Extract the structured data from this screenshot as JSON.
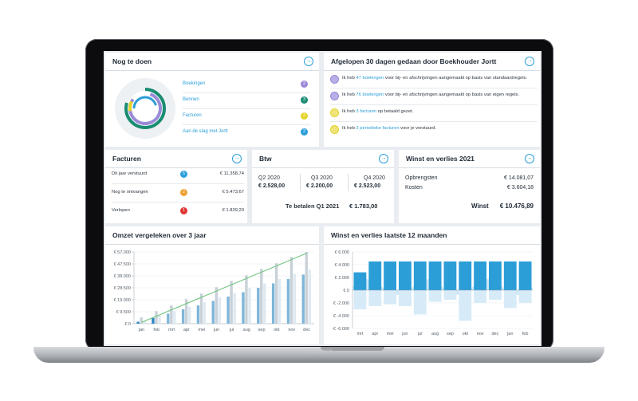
{
  "device": {
    "brand": "MacBook"
  },
  "colors": {
    "accent": "#2b9ed8",
    "green": "#5bbf6b",
    "purple": "#9b8ad8",
    "yellow": "#e3d42a",
    "orange": "#f0a030",
    "red": "#e03535",
    "teal": "#1a8c72"
  },
  "todo": {
    "title": "Nog te doen",
    "items": [
      {
        "label": "Boekingen",
        "count": "2",
        "color": "#9b8ad8"
      },
      {
        "label": "Bennen",
        "count": "3",
        "color": "#1a8c72"
      },
      {
        "label": "Facturen",
        "count": "2",
        "color": "#e3d42a"
      },
      {
        "label": "Aan de slag met Jortt",
        "count": "2",
        "color": "#2b9ed8"
      }
    ]
  },
  "activity": {
    "title": "Afgelopen 30 dagen gedaan door Boekhouder Jortt",
    "items": [
      {
        "icon": "purple-doc-icon",
        "color": "#9b8ad8",
        "pre": "Ik heb ",
        "link": "47 boekingen",
        "post": " voor bij- en afschrijvingen aangemaakt op basis van standaardregels."
      },
      {
        "icon": "purple-doc-icon",
        "color": "#9b8ad8",
        "pre": "Ik heb ",
        "link": "76 boekingen",
        "post": " voor bij- en afschrijvingen aangemaakt op basis van eigen regels."
      },
      {
        "icon": "yellow-check-icon",
        "color": "#e3d42a",
        "pre": "Ik heb ",
        "link": "3 facturen",
        "post": " op betaald gezet."
      },
      {
        "icon": "yellow-check-icon",
        "color": "#e3d42a",
        "pre": "Ik heb ",
        "link": "3 periodieke facturen",
        "post": " voor je verstuurd."
      }
    ]
  },
  "facturen": {
    "title": "Facturen",
    "rows": [
      {
        "label": "Dit jaar verstuurd",
        "count": "5",
        "color": "#2b9ed8",
        "amount": "€ 11.358,74"
      },
      {
        "label": "Nog te ontvangen",
        "count": "2",
        "color": "#f0a030",
        "amount": "€ 5.473,67"
      },
      {
        "label": "Verlopen",
        "count": "1",
        "color": "#e03535",
        "amount": "€ 1.839,20"
      }
    ]
  },
  "btw": {
    "title": "Btw",
    "quarters": [
      {
        "label": "Q2 2020",
        "value": "€ 2.528,00"
      },
      {
        "label": "Q3 2020",
        "value": "€ 2.200,00"
      },
      {
        "label": "Q4 2020",
        "value": "€ 2.523,00"
      }
    ],
    "pay_label": "Te betalen Q1 2021",
    "pay_value": "€ 1.783,00"
  },
  "winst": {
    "title": "Winst en verlies 2021",
    "revenue_label": "Opbrengsten",
    "revenue_value": "€ 14.081,07",
    "cost_label": "Kosten",
    "cost_value": "€ 3.604,18",
    "profit_label": "Winst",
    "profit_value": "€ 10.476,89"
  },
  "chart_titles": {
    "omzet": "Omzet vergeleken over 3 jaar",
    "wv12": "Winst en verlies laatste 12 maanden"
  },
  "chart_data": [
    {
      "type": "bar",
      "categories": [
        "jan",
        "feb",
        "mrt",
        "apr",
        "mei",
        "jun",
        "jul",
        "aug",
        "sep",
        "okt",
        "nov",
        "dec"
      ],
      "yticks": [
        "€ 0",
        "€ 9.500",
        "€ 19.000",
        "€ 28.500",
        "€ 38.000",
        "€ 47.500",
        "€ 57.000"
      ],
      "ylim": [
        0,
        57000
      ],
      "series": [
        {
          "values": [
            1500,
            4500,
            8000,
            11500,
            14500,
            18000,
            21500,
            25000,
            28500,
            32000,
            35500,
            39000
          ]
        },
        {
          "values": [
            5000,
            10000,
            14500,
            19500,
            24000,
            29000,
            34000,
            38500,
            43500,
            48000,
            53000,
            57000
          ]
        },
        {
          "values": [
            2500,
            6500,
            10000,
            13500,
            17000,
            21000,
            24500,
            28500,
            32000,
            35500,
            39500,
            43000
          ]
        }
      ],
      "trend": [
        1000,
        56000
      ]
    },
    {
      "type": "bar",
      "categories": [
        "mrt",
        "apr",
        "mei",
        "jun",
        "jul",
        "aug",
        "sep",
        "okt",
        "nov",
        "dec",
        "jan",
        "feb"
      ],
      "yticks": [
        "€ -6.000",
        "€ -4.000",
        "€ -2.000",
        "€ 0",
        "€ 2.000",
        "€ 4.000",
        "€ 6.000"
      ],
      "ylim": [
        -6000,
        6000
      ],
      "series": [
        {
          "values": [
            2800,
            4500,
            4500,
            4500,
            4500,
            4500,
            4500,
            4500,
            4500,
            4500,
            4500,
            4500
          ]
        },
        {
          "values": [
            -3000,
            -2500,
            -2200,
            -2500,
            -3800,
            -1800,
            -1500,
            -4800,
            -2000,
            -1500,
            -2800,
            -2000
          ]
        }
      ]
    }
  ]
}
